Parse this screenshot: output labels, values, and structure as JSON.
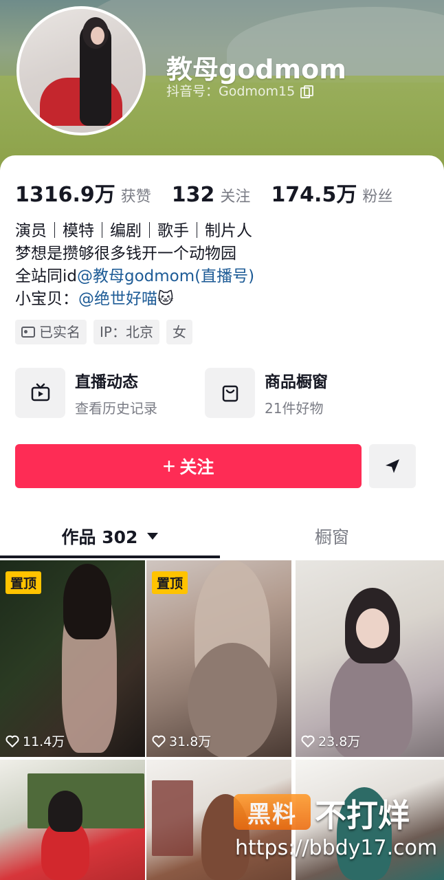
{
  "profile": {
    "name": "教母godmom",
    "douyin_id": "抖音号：Godmom15"
  },
  "stats": [
    {
      "num": "1316.9万",
      "label": "获赞"
    },
    {
      "num": "132",
      "label": "关注"
    },
    {
      "num": "174.5万",
      "label": "粉丝"
    }
  ],
  "bio": {
    "line1": "演员｜模特｜编剧｜歌手｜制片人",
    "line2": "梦想是攒够很多钱开一个动物园",
    "line3_prefix": "全站同id",
    "line3_mention": "@教母godmom(直播号)",
    "line4_prefix": "小宝贝：",
    "line4_mention": "@绝世好喵",
    "line4_emoji": "🐱"
  },
  "tags": {
    "verified": "已实名",
    "ip": "IP：北京",
    "gender": "女"
  },
  "features": [
    {
      "title": "直播动态",
      "subtitle": "查看历史记录",
      "icon": "tv-icon"
    },
    {
      "title": "商品橱窗",
      "subtitle": "21件好物",
      "icon": "shopping-bag-icon"
    }
  ],
  "actions": {
    "follow_plus": "+",
    "follow_label": "关注",
    "share_icon": "send-icon"
  },
  "tabs": {
    "works": "作品 302",
    "window": "橱窗"
  },
  "videos": [
    {
      "pinned": "置顶",
      "likes": "11.4万"
    },
    {
      "pinned": "置顶",
      "likes": "31.8万"
    },
    {
      "pinned": "",
      "likes": "23.8万"
    }
  ],
  "watermark": {
    "logo": "黑料",
    "text": "不打烊",
    "url": "https://bbdy17.com"
  },
  "colors": {
    "accent": "#fe2c55",
    "mention": "#1d5b96",
    "pinned_badge": "#ffc300"
  }
}
